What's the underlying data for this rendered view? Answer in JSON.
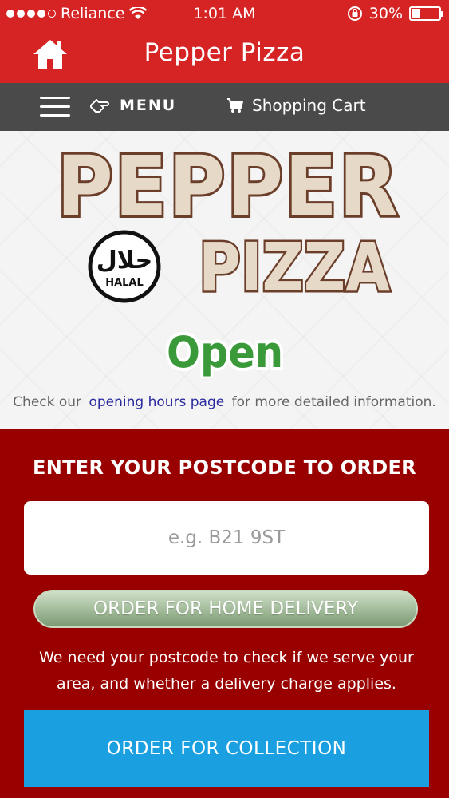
{
  "status_bar": {
    "carrier": "Reliance",
    "time": "1:01 AM",
    "battery_percent": "30%",
    "battery_level": 0.3
  },
  "header": {
    "title": "Pepper Pizza",
    "home_icon": "home-icon"
  },
  "nav": {
    "menu_label": "MENU",
    "cart_label": "Shopping Cart",
    "hamburger_icon": "hamburger-icon",
    "menu_icon": "hand-pointer-icon",
    "cart_icon": "cart-icon"
  },
  "hero": {
    "logo_line1": "PEPPER",
    "logo_line2": "PIZZA",
    "halal_arabic": "حلال",
    "halal_text": "HALAL",
    "open_status": "Open",
    "hours_prefix": "Check our",
    "hours_link": "opening hours page",
    "hours_suffix": "for more detailed information."
  },
  "order": {
    "heading": "ENTER YOUR POSTCODE TO ORDER",
    "postcode_placeholder": "e.g. B21 9ST",
    "postcode_value": "",
    "delivery_button": "ORDER FOR HOME DELIVERY",
    "note": "We need your postcode to check if we serve your area, and whether a delivery charge applies.",
    "collection_button": "ORDER FOR COLLECTION"
  },
  "colors": {
    "header_red": "#d62424",
    "nav_gray": "#4a4a4a",
    "order_red": "#990000",
    "collection_blue": "#1aa0e0",
    "delivery_green": "#7b9a72",
    "open_green": "#3a9a3a"
  }
}
